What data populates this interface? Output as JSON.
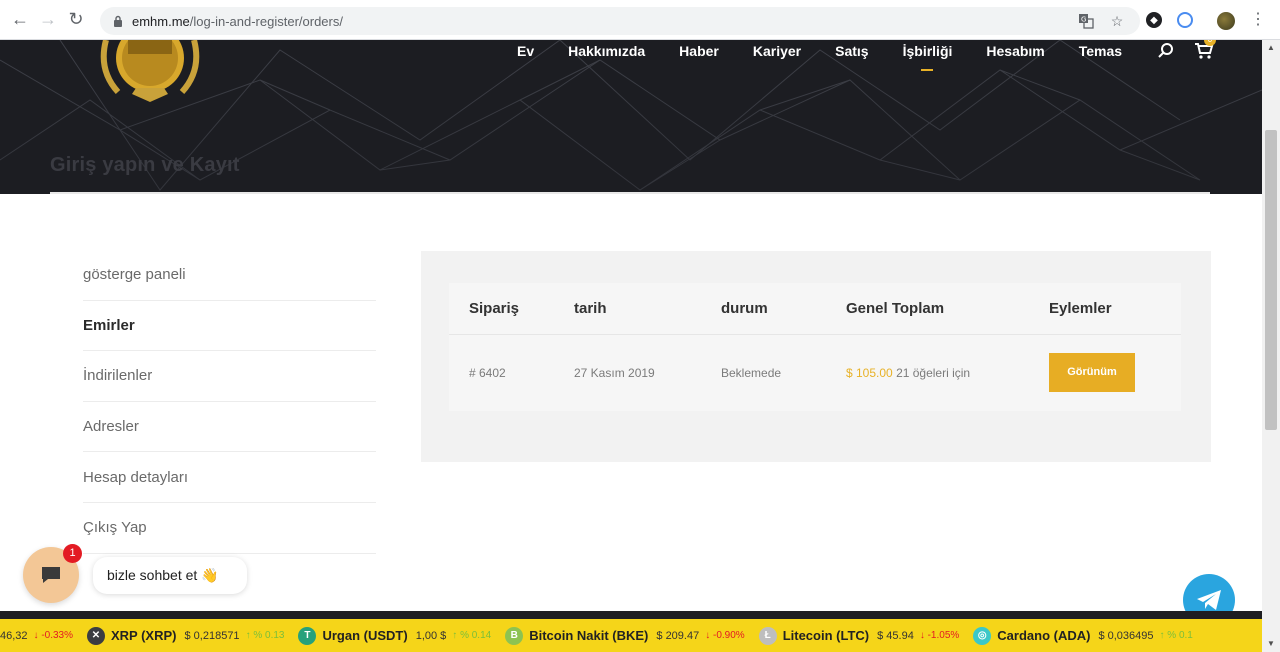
{
  "browser": {
    "url_host": "emhm.me",
    "url_path": "/log-in-and-register/orders/"
  },
  "header": {
    "nav": [
      "Ev",
      "Hakkımızda",
      "Haber",
      "Kariyer",
      "Satış",
      "İşbirliği",
      "Hesabım",
      "Temas"
    ],
    "active_nav_index": 5,
    "cart_count": "0",
    "hero_title": "Giriş yapın ve Kayıt"
  },
  "account_nav": {
    "items": [
      "gösterge paneli",
      "Emirler",
      "İndirilenler",
      "Adresler",
      "Hesap detayları",
      "Çıkış Yap"
    ],
    "active_index": 1
  },
  "orders": {
    "headers": [
      "Sipariş",
      "tarih",
      "durum",
      "Genel Toplam",
      "Eylemler"
    ],
    "rows": [
      {
        "order": "# 6402",
        "date": "27 Kasım 2019",
        "status": "Beklemede",
        "total_price": "$ 105.00",
        "total_items": "21 öğeleri için",
        "action": "Görünüm"
      }
    ]
  },
  "chat": {
    "badge": "1",
    "prompt": "bizle sohbet et 👋"
  },
  "ticker": [
    {
      "name": "",
      "price": "46,32",
      "change": "-0.33%",
      "dir": "down",
      "color": "#f5d519",
      "icon": ""
    },
    {
      "name": "XRP (XRP)",
      "price": "$ 0,218571",
      "change": "% 0.13",
      "dir": "up",
      "color": "#3b3d42",
      "icon": "x-icon"
    },
    {
      "name": "Urgan (USDT)",
      "price": "1,00 $",
      "change": "% 0.14",
      "dir": "up",
      "color": "#26a17b",
      "icon": "tether-icon"
    },
    {
      "name": "Bitcoin Nakit (BKE)",
      "price": "$ 209.47",
      "change": "-0.90%",
      "dir": "down",
      "color": "#8dc351",
      "icon": "bitcoin-cash-icon"
    },
    {
      "name": "Litecoin (LTC)",
      "price": "$ 45.94",
      "change": "-1.05%",
      "dir": "down",
      "color": "#bebebe",
      "icon": "litecoin-icon"
    },
    {
      "name": "Cardano (ADA)",
      "price": "$ 0,036495",
      "change": "% 0.1",
      "dir": "up",
      "color": "#3cc8c8",
      "icon": "cardano-icon"
    }
  ],
  "colors": {
    "accent": "#e7ad24",
    "ticker_bg": "#f5d519",
    "hero_bg": "#1c1d22"
  }
}
